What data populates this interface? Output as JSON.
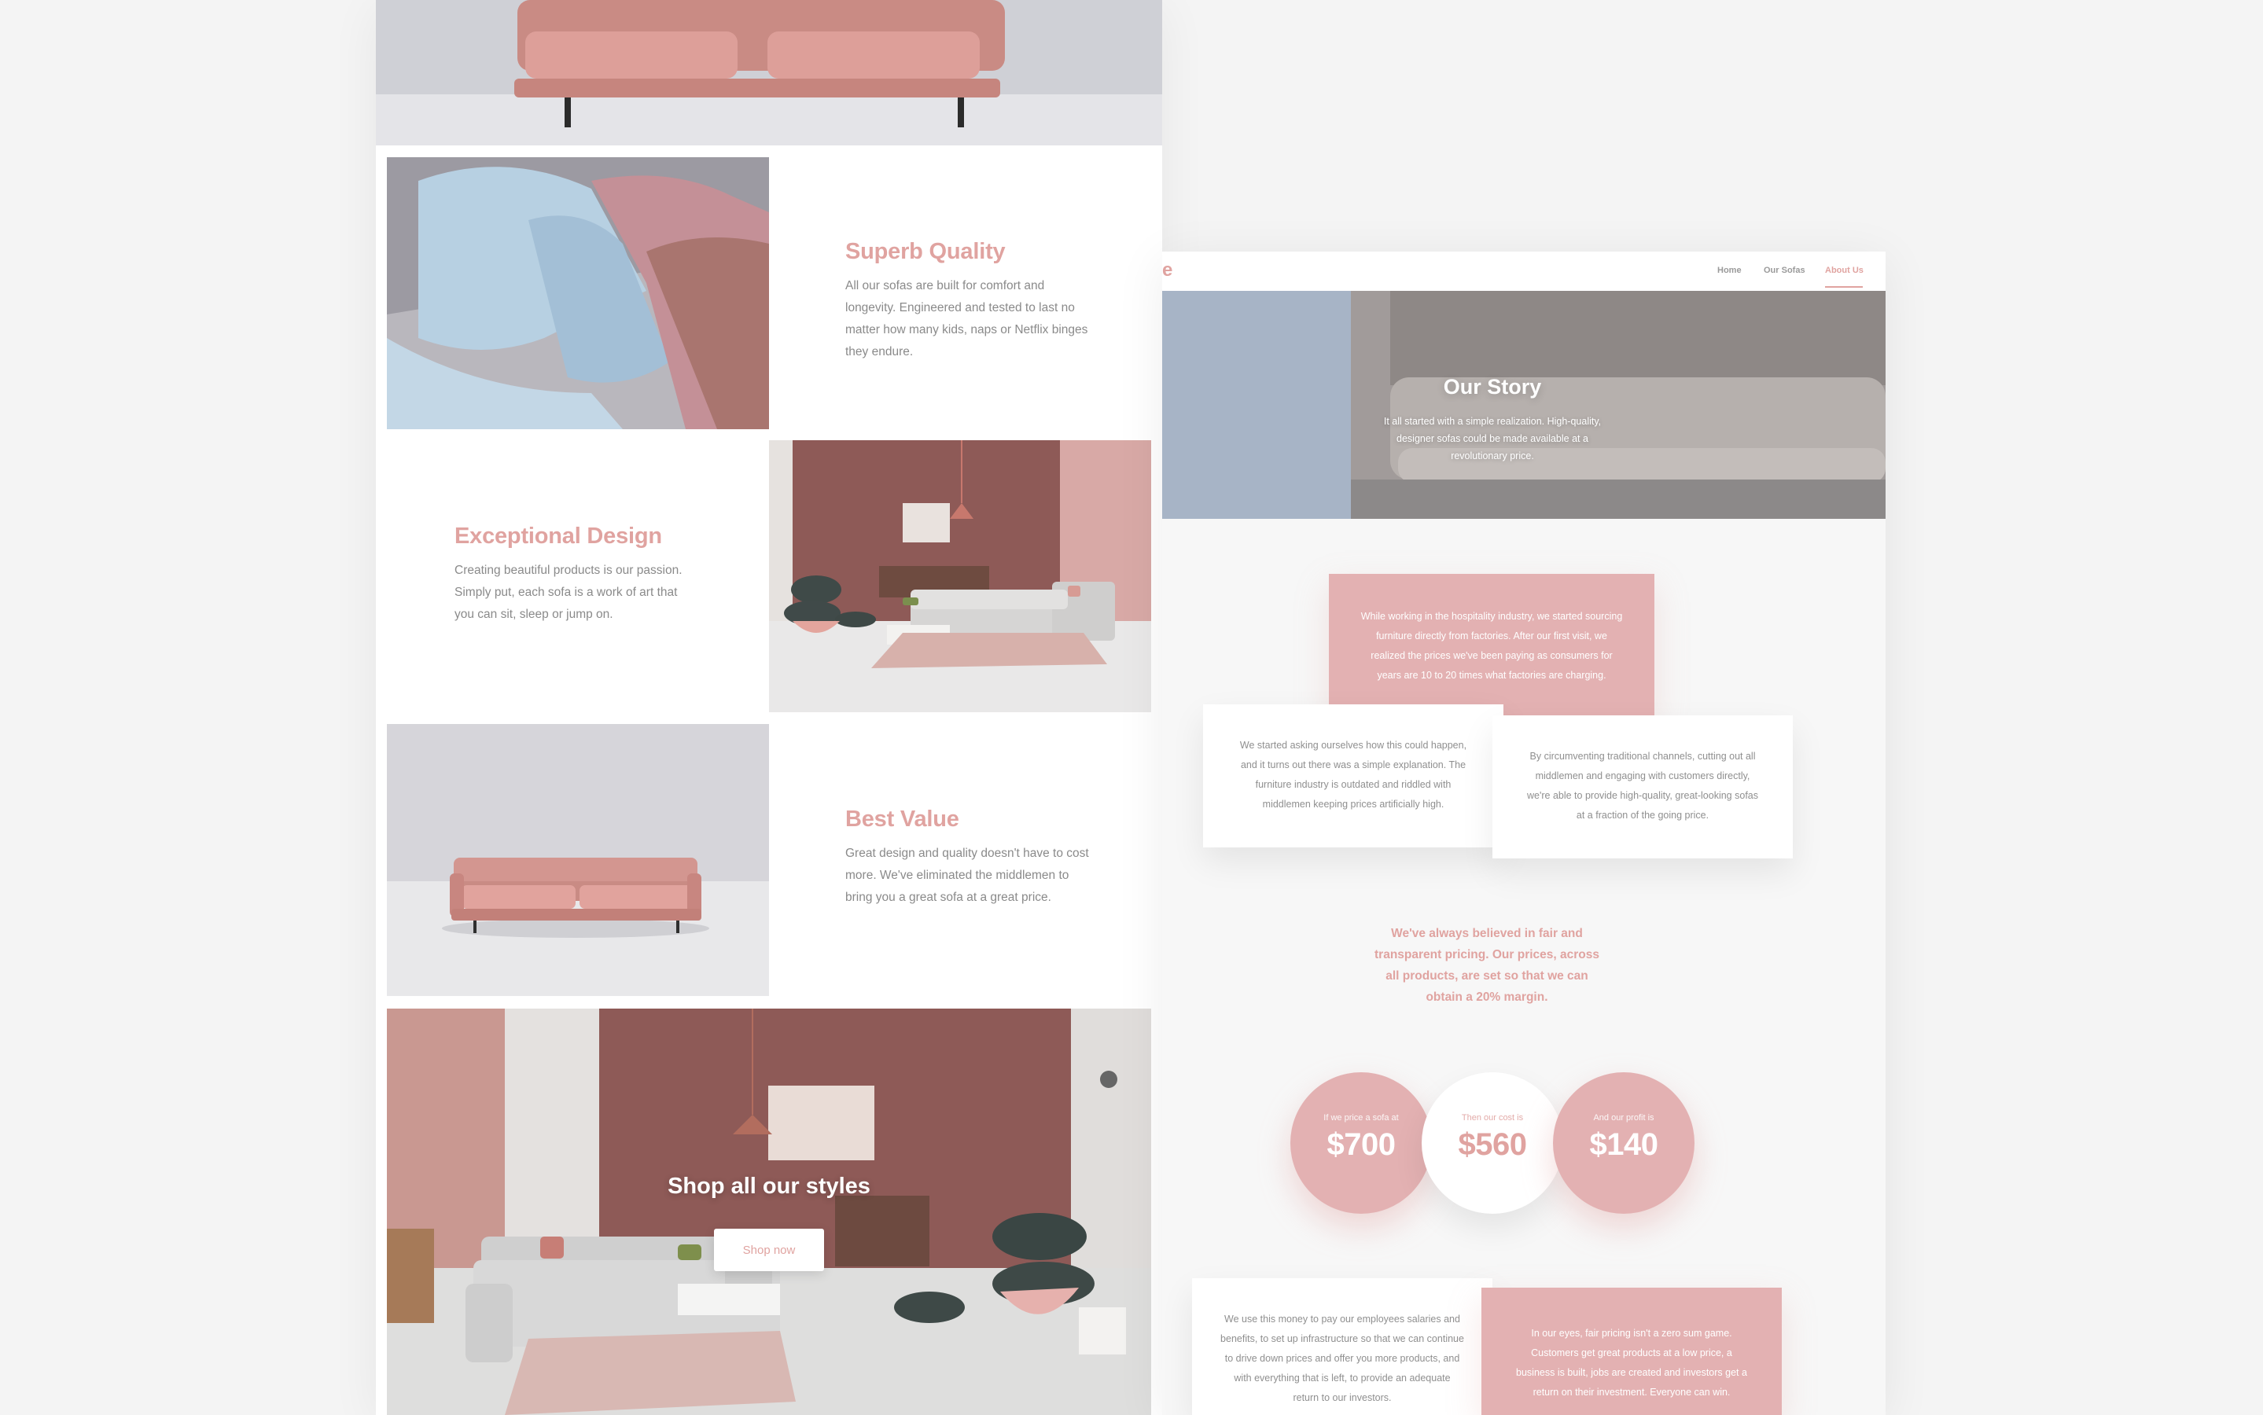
{
  "left": {
    "features": [
      {
        "title": "Superb Quality",
        "text": "All our sofas are built for comfort and longevity. Engineered and tested to last no matter how many kids, naps or Netflix binges they endure."
      },
      {
        "title": "Exceptional Design",
        "text": "Creating beautiful products is our passion. Simply put, each sofa is a work of art that you can sit, sleep or jump on."
      },
      {
        "title": "Best Value",
        "text": "Great design and quality doesn't have to cost more. We've eliminated the middlemen to bring you a great sofa at a great price."
      }
    ],
    "shop": {
      "title": "Shop all our styles",
      "button": "Shop now"
    }
  },
  "right": {
    "nav": {
      "logo_fragment": "e",
      "links": [
        "Home",
        "Our Sofas",
        "About Us"
      ],
      "active": "About Us"
    },
    "hero": {
      "title": "Our Story",
      "text": "It all started with a simple realization. High-quality, designer sofas could be made available at a revolutionary price."
    },
    "story": [
      "While working in the hospitality industry, we started sourcing furniture directly from factories. After our first visit, we realized the prices we've been paying as consumers for years are 10 to 20 times what factories are charging.",
      "We started asking ourselves how this could happen, and it turns out there was a simple explanation. The furniture industry is outdated and riddled with middlemen keeping prices artificially high.",
      "By circumventing traditional channels, cutting out all middlemen and engaging with customers directly, we're able to provide high-quality, great-looking sofas at a fraction of the going price."
    ],
    "belief": "We've always believed in fair and transparent pricing. Our prices, across all products, are set so that we can obtain a 20% margin.",
    "pricing": [
      {
        "label": "If we price a sofa at",
        "amount": "$700"
      },
      {
        "label": "Then our cost is",
        "amount": "$560"
      },
      {
        "label": "And our profit is",
        "amount": "$140"
      }
    ],
    "bottom": [
      "We use this money to pay our employees salaries and benefits, to set up infrastructure so that we can continue to drive down prices and offer you more products, and with everything that is left, to provide an adequate return to our investors.",
      "In our eyes, fair pricing isn't a zero sum game. Customers get great products at a low price, a business is built, jobs are created and investors get a return on their investment. Everyone can win."
    ]
  },
  "colors": {
    "accent": "#e0a3a0",
    "accent_card": "#e3b1b2",
    "body_text": "#8a8a8a",
    "background": "#f4f4f4"
  }
}
